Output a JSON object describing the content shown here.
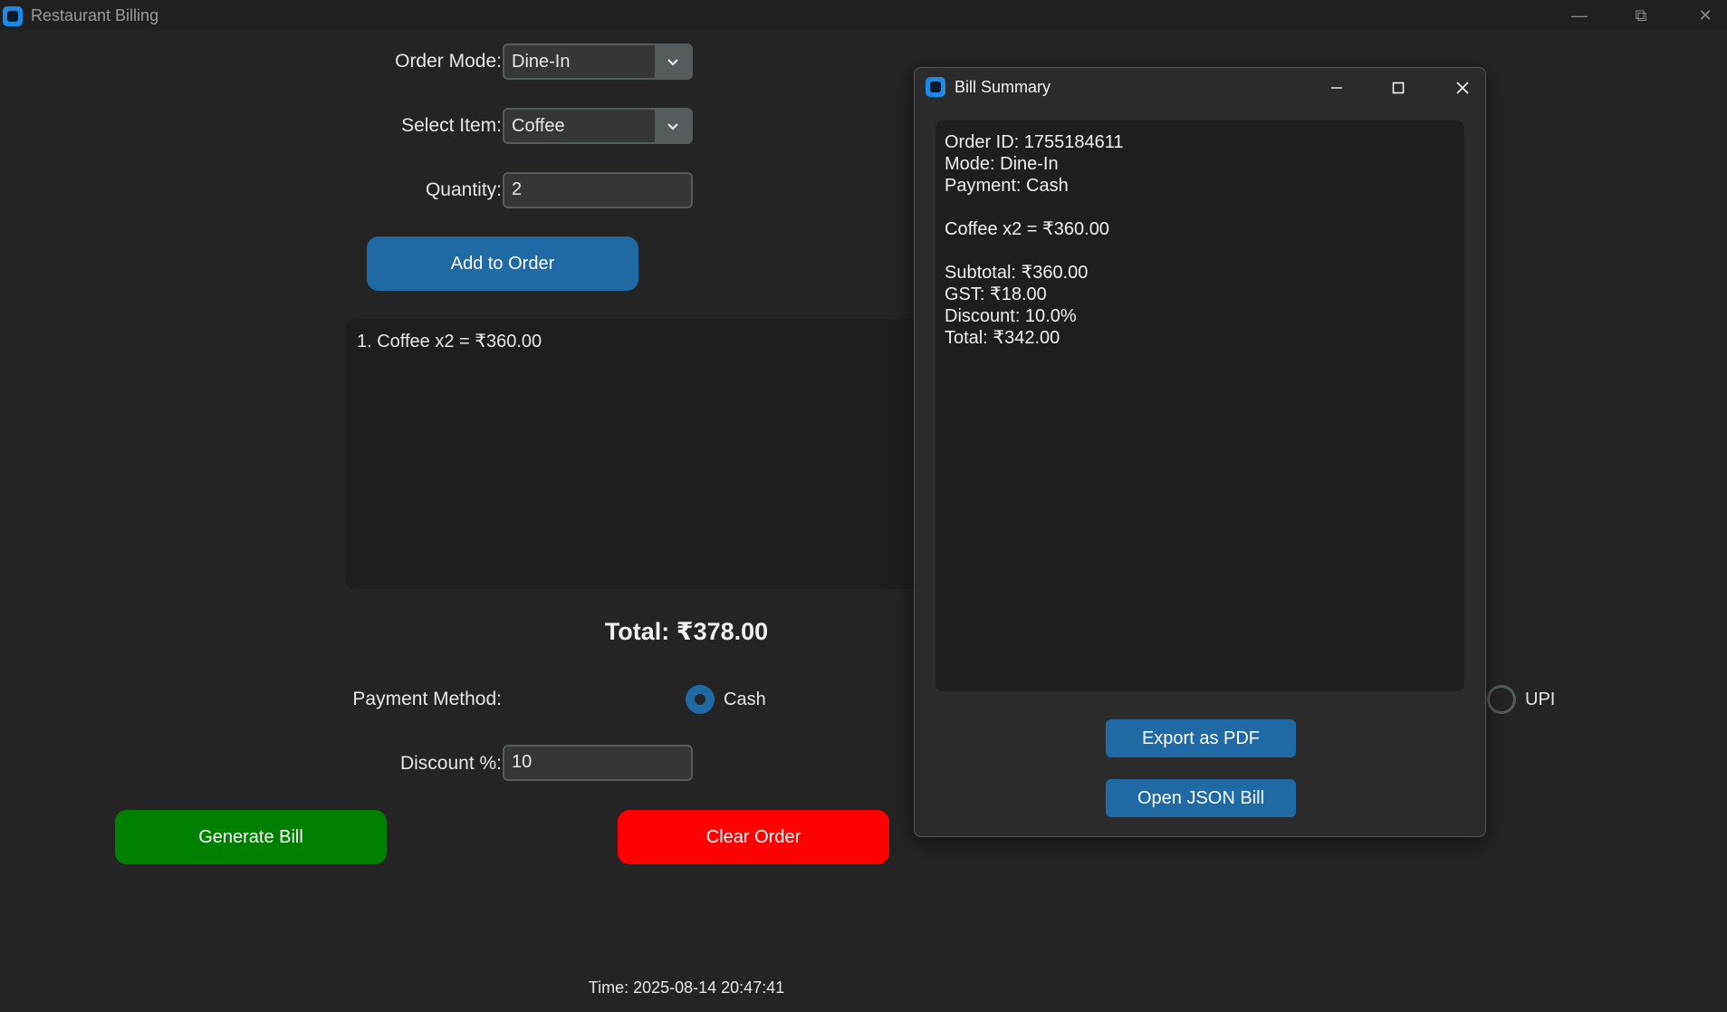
{
  "window": {
    "title": "Restaurant Billing",
    "controls": {
      "minimize": "—",
      "restore": "⧉",
      "close": "✕"
    }
  },
  "form": {
    "order_mode": {
      "label": "Order Mode:",
      "value": "Dine-In"
    },
    "select_item": {
      "label": "Select Item:",
      "value": "Coffee"
    },
    "quantity": {
      "label": "Quantity:",
      "value": "2"
    },
    "add_button": "Add to Order",
    "order_items": [
      "1. Coffee x2 = ₹360.00"
    ],
    "total": "Total: ₹378.00",
    "payment": {
      "label": "Payment Method:",
      "options": [
        {
          "label": "Cash",
          "selected": true
        },
        {
          "label": "UPI",
          "selected": false
        }
      ]
    },
    "discount": {
      "label": "Discount %:",
      "value": "10"
    },
    "generate_button": "Generate Bill",
    "clear_button": "Clear Order",
    "time": "Time: 2025-08-14 20:47:41"
  },
  "colors": {
    "accent": "#1f6aa5",
    "generate": "#008000",
    "clear": "#ff0000",
    "background": "#242424"
  },
  "dialog": {
    "title": "Bill Summary",
    "lines": [
      "Order ID: 1755184611",
      "Mode: Dine-In",
      "Payment: Cash",
      "",
      "Coffee x2 = ₹360.00",
      "",
      "Subtotal: ₹360.00",
      "GST: ₹18.00",
      "Discount: 10.0%",
      "Total: ₹342.00"
    ],
    "export_button": "Export as PDF",
    "json_button": "Open JSON Bill"
  }
}
